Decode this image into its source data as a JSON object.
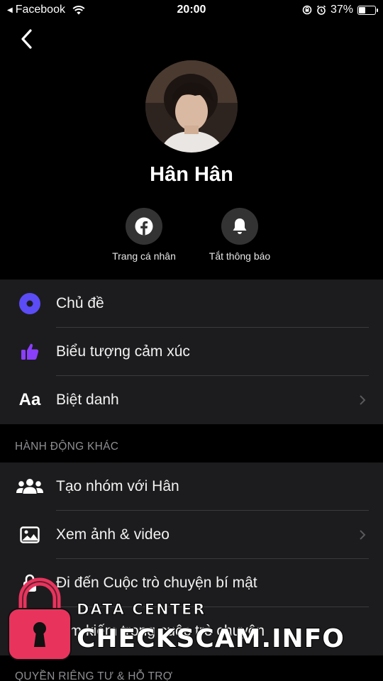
{
  "status_bar": {
    "back_app": "Facebook",
    "time": "20:00",
    "battery": "37%",
    "battery_level": 0.37
  },
  "profile": {
    "name": "Hân Hân",
    "actions": [
      {
        "label": "Trang cá nhân",
        "icon": "facebook-icon"
      },
      {
        "label": "Tắt thông báo",
        "icon": "bell-icon"
      }
    ]
  },
  "customize": {
    "items": [
      {
        "label": "Chủ đề",
        "icon": "theme-icon"
      },
      {
        "label": "Biểu tượng cảm xúc",
        "icon": "thumbs-up-icon"
      },
      {
        "label": "Biệt danh",
        "icon": "nickname-icon",
        "icon_text": "Aa"
      }
    ]
  },
  "more_actions": {
    "title": "HÀNH ĐỘNG KHÁC",
    "items": [
      {
        "label": "Tạo nhóm với Hân",
        "icon": "group-icon"
      },
      {
        "label": "Xem ảnh & video",
        "icon": "photo-icon"
      },
      {
        "label": "Đi đến Cuộc trò chuyện bí mật",
        "icon": "lock-icon"
      },
      {
        "label": "Tìm kiếm trong cuộc trò chuyện",
        "icon": "search-icon"
      }
    ]
  },
  "privacy": {
    "title": "QUYỀN RIÊNG TƯ & HỖ TRỢ"
  },
  "watermark": {
    "line1": "DATA CENTER",
    "line2": "CHECKSCAM.INFO"
  },
  "colors": {
    "background": "#000000",
    "card": "#1c1c1e",
    "theme_accent": "#5b4cf5",
    "like_accent": "#8a3ffc",
    "watermark_lock": "#e8345d"
  }
}
